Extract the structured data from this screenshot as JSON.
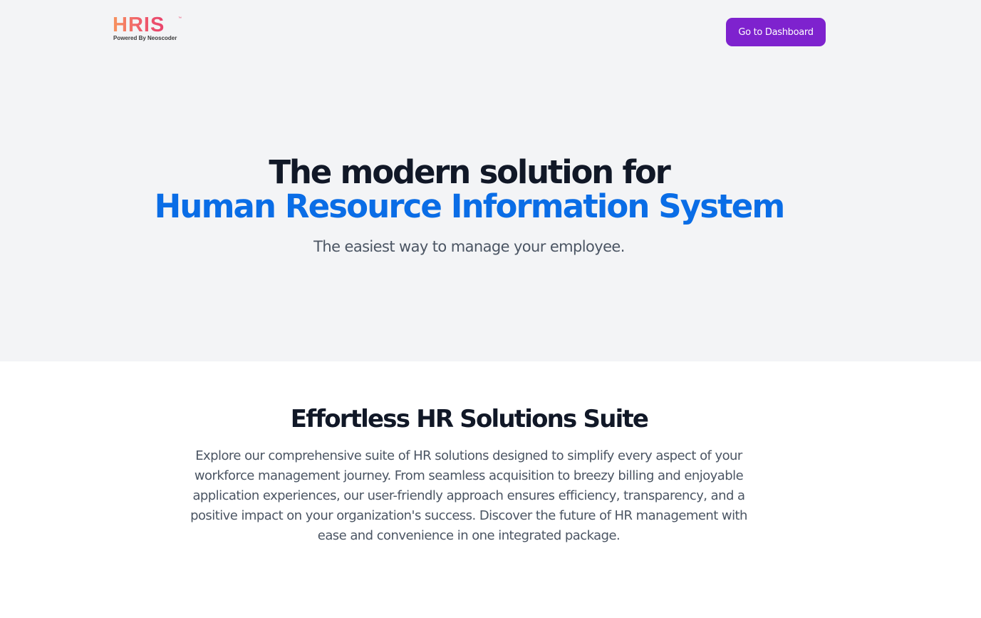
{
  "header": {
    "logo_text": "HRIS",
    "logo_tm": "™",
    "logo_subtitle": "Powered By Neoscoder",
    "dashboard_button_label": "Go to Dashboard"
  },
  "hero": {
    "title_line1": "The modern solution for",
    "title_line2": "Human Resource Information System",
    "subtitle": "The easiest way to manage your employee."
  },
  "features": {
    "title": "Effortless HR Solutions Suite",
    "description": "Explore our comprehensive suite of HR solutions designed to simplify every aspect of your workforce management journey. From seamless acquisition to breezy billing and enjoyable application experiences, our user-friendly approach ensures efficiency, transparency, and a positive impact on your organization's success. Discover the future of HR management with ease and convenience in one integrated package."
  },
  "colors": {
    "hero_background": "#f3f4f6",
    "accent_blue": "#0a6de6",
    "button_purple": "#7e22ce",
    "logo_gradient_start": "#f7945e",
    "logo_gradient_end": "#e8436c"
  }
}
